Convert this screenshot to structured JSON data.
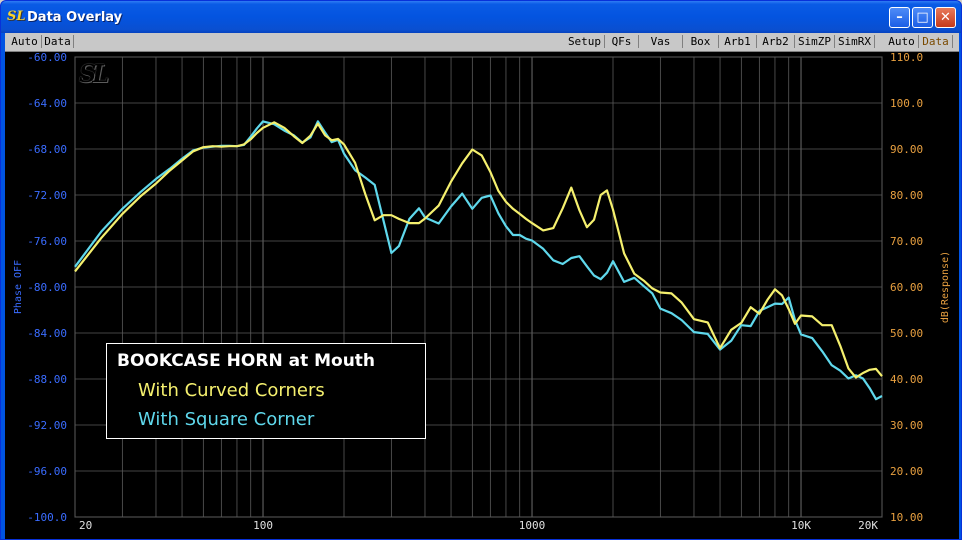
{
  "window": {
    "title": "Data Overlay"
  },
  "toolbar": {
    "left": [
      "Auto",
      "Data"
    ],
    "middle": [
      "Setup",
      "QFs",
      "Vas",
      "Box",
      "Arb1",
      "Arb2",
      "SimZP",
      "SimRX"
    ],
    "right": [
      "Auto",
      "Data"
    ]
  },
  "logo": "SL",
  "legend": {
    "title": "BOOKCASE HORN at Mouth",
    "items": [
      "With Curved Corners",
      "With Square Corner"
    ]
  },
  "colors": {
    "curved": "#f5f06e",
    "square": "#5fd8ec",
    "left_axis": "#3a6cff",
    "right_axis": "#e8a040",
    "grid": "#5a5a5a"
  },
  "chart_data": {
    "type": "line",
    "xscale": "log",
    "xlim": [
      20,
      20000
    ],
    "x_ticks": [
      {
        "v": 20,
        "label": "20"
      },
      {
        "v": 100,
        "label": "100"
      },
      {
        "v": 1000,
        "label": "1000"
      },
      {
        "v": 10000,
        "label": "10K"
      },
      {
        "v": 20000,
        "label": "20K"
      }
    ],
    "ylabel_left": "Phase OFF",
    "ylim_left": [
      -100,
      -60
    ],
    "yticks_left": [
      "-60.00",
      "-64.00",
      "-68.00",
      "-72.00",
      "-76.00",
      "-80.00",
      "-84.00",
      "-88.00",
      "-92.00",
      "-96.00",
      "-100.0"
    ],
    "ylabel_right": "dB(Response)",
    "ylim_right": [
      10,
      110
    ],
    "yticks_right": [
      "110.0",
      "100.0",
      "90.00",
      "80.00",
      "70.00",
      "60.00",
      "50.00",
      "40.00",
      "30.00",
      "20.00",
      "10.00"
    ],
    "series": [
      {
        "name": "With Curved Corners",
        "x": [
          20,
          25,
          30,
          35,
          40,
          45,
          50,
          55,
          60,
          65,
          70,
          75,
          80,
          85,
          90,
          95,
          100,
          110,
          120,
          130,
          140,
          150,
          160,
          170,
          180,
          190,
          200,
          220,
          240,
          260,
          280,
          300,
          320,
          350,
          380,
          400,
          450,
          500,
          550,
          600,
          650,
          700,
          750,
          800,
          850,
          900,
          950,
          1000,
          1100,
          1200,
          1300,
          1400,
          1500,
          1600,
          1700,
          1800,
          1900,
          2000,
          2200,
          2400,
          2600,
          2800,
          3000,
          3300,
          3600,
          4000,
          4500,
          5000,
          5500,
          6000,
          6500,
          7000,
          7500,
          8000,
          8500,
          9000,
          9500,
          10000,
          11000,
          12000,
          13000,
          14000,
          15000,
          16000,
          17000,
          18000,
          19000,
          20000
        ],
        "y": [
          63.4,
          70.6,
          75.9,
          79.7,
          82.5,
          85.3,
          87.5,
          89.5,
          90.4,
          90.6,
          90.5,
          90.6,
          90.6,
          91.0,
          92.1,
          93.5,
          94.6,
          95.8,
          94.6,
          92.8,
          91.3,
          92.9,
          95.5,
          93.0,
          91.9,
          92.2,
          91.0,
          87.0,
          80.2,
          74.5,
          75.6,
          75.6,
          74.8,
          73.9,
          73.9,
          74.9,
          77.7,
          82.9,
          86.9,
          89.9,
          88.6,
          85.0,
          80.9,
          78.5,
          77.0,
          75.9,
          74.8,
          73.9,
          72.3,
          72.8,
          77.1,
          81.6,
          76.7,
          73.0,
          74.6,
          80.0,
          81.0,
          76.8,
          67.3,
          62.9,
          61.4,
          59.7,
          58.8,
          58.6,
          56.6,
          53.0,
          52.3,
          46.7,
          50.7,
          52.2,
          55.6,
          54.2,
          57.2,
          59.5,
          58.2,
          55.2,
          52.0,
          53.8,
          53.6,
          51.7,
          51.7,
          47.2,
          42.3,
          40.3,
          41.3,
          42.0,
          42.2,
          40.6
        ]
      },
      {
        "name": "With Square Corner",
        "x": [
          20,
          25,
          30,
          35,
          40,
          45,
          50,
          55,
          60,
          65,
          70,
          75,
          80,
          85,
          90,
          95,
          100,
          110,
          120,
          130,
          140,
          150,
          160,
          170,
          180,
          190,
          200,
          220,
          240,
          260,
          280,
          300,
          320,
          350,
          380,
          400,
          450,
          500,
          550,
          600,
          650,
          700,
          750,
          800,
          850,
          900,
          950,
          1000,
          1100,
          1200,
          1300,
          1400,
          1500,
          1600,
          1700,
          1800,
          1900,
          2000,
          2200,
          2400,
          2600,
          2800,
          3000,
          3300,
          3600,
          4000,
          4500,
          5000,
          5500,
          6000,
          6500,
          7000,
          7500,
          8000,
          8500,
          9000,
          9500,
          10000,
          11000,
          12000,
          13000,
          14000,
          15000,
          16000,
          17000,
          18000,
          19000,
          20000
        ],
        "y": [
          64.4,
          72.0,
          77.0,
          80.6,
          83.5,
          85.7,
          87.9,
          89.7,
          90.3,
          90.5,
          90.7,
          90.7,
          90.6,
          90.9,
          92.7,
          94.5,
          96.0,
          95.4,
          94.0,
          93.0,
          91.4,
          92.5,
          96.0,
          93.6,
          91.5,
          92.0,
          89.0,
          85.4,
          83.8,
          82.2,
          74.6,
          67.4,
          68.9,
          74.8,
          77.1,
          75.1,
          73.8,
          77.5,
          80.3,
          77.0,
          79.4,
          79.9,
          76.0,
          73.2,
          71.3,
          71.3,
          70.5,
          70.1,
          68.3,
          65.8,
          65.0,
          66.3,
          66.7,
          64.5,
          62.5,
          61.7,
          63.1,
          65.6,
          61.1,
          62.0,
          60.2,
          58.6,
          55.3,
          54.3,
          52.8,
          50.2,
          49.8,
          46.4,
          48.3,
          51.7,
          51.5,
          54.8,
          55.6,
          56.4,
          56.3,
          57.7,
          52.8,
          49.7,
          48.9,
          46.0,
          43.0,
          41.8,
          40.1,
          40.8,
          40.1,
          38.0,
          35.6,
          36.3
        ]
      }
    ]
  }
}
